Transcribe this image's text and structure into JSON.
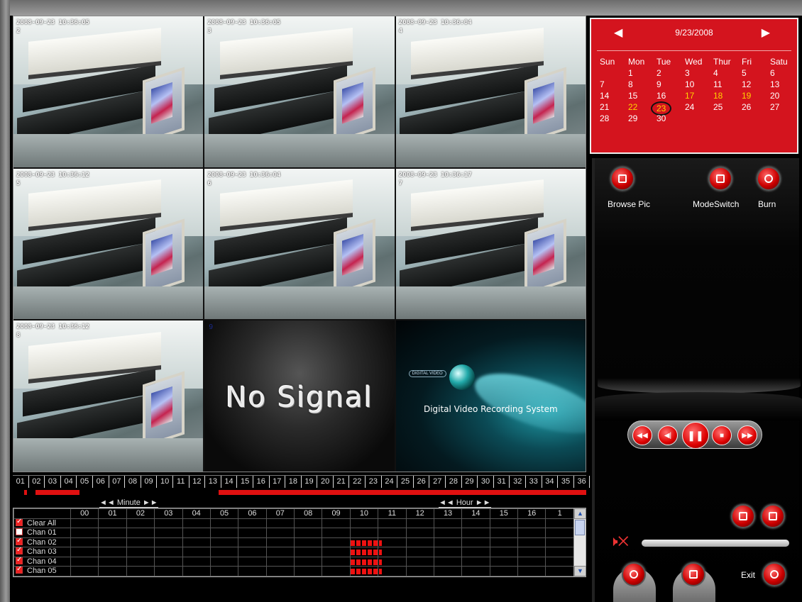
{
  "cameras": [
    {
      "timestamp": "2008-09-23 10:36:05",
      "channel": "2"
    },
    {
      "timestamp": "2008-09-23 10:36:05",
      "channel": "3"
    },
    {
      "timestamp": "2008-09-23 10:36:04",
      "channel": "4"
    },
    {
      "timestamp": "2008-09-23 10:36:12",
      "channel": "5"
    },
    {
      "timestamp": "2008-09-23 10:36:04",
      "channel": "6"
    },
    {
      "timestamp": "2008-09-23 10:36:17",
      "channel": "7"
    },
    {
      "timestamp": "2008-09-23 10:36:12",
      "channel": "8"
    }
  ],
  "no_signal": {
    "text": "No Signal",
    "channel": "9"
  },
  "dvr_logo": {
    "badge": "DIGITAL VIDEO",
    "caption": "Digital Video Recording System"
  },
  "hour_strip": {
    "numbers": [
      "01",
      "02",
      "03",
      "04",
      "05",
      "06",
      "07",
      "08",
      "09",
      "10",
      "11",
      "12",
      "13",
      "14",
      "15",
      "16",
      "17",
      "18",
      "19",
      "20",
      "21",
      "22",
      "23",
      "24",
      "25",
      "26",
      "27",
      "28",
      "29",
      "30",
      "31",
      "32",
      "33",
      "34",
      "35",
      "36"
    ]
  },
  "timeline": {
    "minute_label": "◄◄ Minute ►►",
    "hour_label": "◄◄ Hour ►►",
    "columns": [
      "00",
      "01",
      "02",
      "03",
      "04",
      "05",
      "06",
      "07",
      "08",
      "09",
      "10",
      "11",
      "12",
      "13",
      "14",
      "15",
      "16",
      "1"
    ],
    "rows": [
      {
        "label": "Clear All",
        "checked": true
      },
      {
        "label": "Chan 01",
        "checked": false
      },
      {
        "label": "Chan 02",
        "checked": true
      },
      {
        "label": "Chan 03",
        "checked": true
      },
      {
        "label": "Chan 04",
        "checked": true
      },
      {
        "label": "Chan 05",
        "checked": true
      }
    ]
  },
  "calendar": {
    "month": "9/23/2008",
    "weekdays": [
      "Sun",
      "Mon",
      "Tue",
      "Wed",
      "Thur",
      "Fri",
      "Satu"
    ],
    "days": [
      "",
      "1",
      "2",
      "3",
      "4",
      "5",
      "6",
      "7",
      "8",
      "9",
      "10",
      "11",
      "12",
      "13",
      "14",
      "15",
      "16",
      "17",
      "18",
      "19",
      "20",
      "21",
      "22",
      "23",
      "24",
      "25",
      "26",
      "27",
      "28",
      "29",
      "30"
    ],
    "highlighted": [
      "17",
      "18",
      "19",
      "22"
    ],
    "selected": "23"
  },
  "panel": {
    "browse_pic": "Browse Pic",
    "mode_switch": "ModeSwitch",
    "burn": "Burn",
    "exit": "Exit"
  },
  "colors": {
    "accent": "#d4141e",
    "highlight": "#ffd200"
  }
}
